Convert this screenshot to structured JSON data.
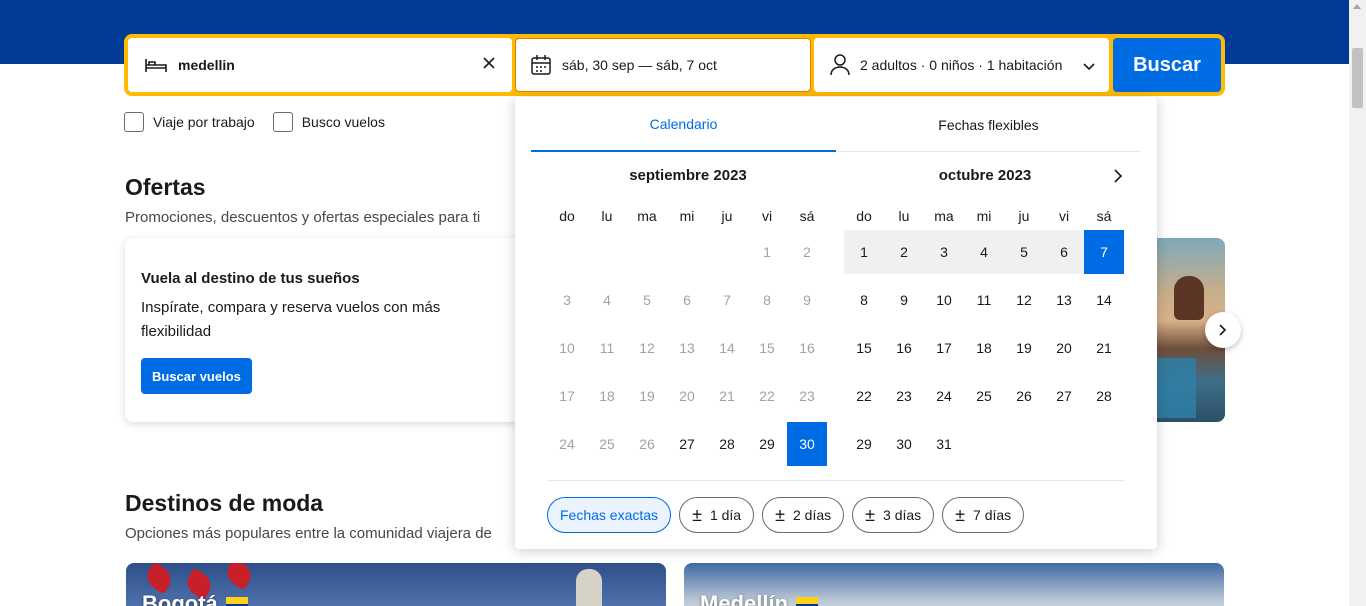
{
  "search": {
    "destination": "medellin",
    "dates": "sáb, 30 sep — sáb, 7 oct",
    "guests": "2 adultos · 0 niños · 1 habitación",
    "button": "Buscar"
  },
  "checkboxes": {
    "work": "Viaje por trabajo",
    "flights": "Busco vuelos"
  },
  "offers": {
    "title": "Ofertas",
    "subtitle": "Promociones, descuentos y ofertas especiales para ti",
    "card_title": "Vuela al destino de tus sueños",
    "card_text": "Inspírate, compara y reserva vuelos con más flexibilidad",
    "card_button": "Buscar vuelos"
  },
  "trending": {
    "title": "Destinos de moda",
    "subtitle": "Opciones más populares entre la comunidad viajera de",
    "cards": [
      "Bogotá",
      "Medellín"
    ]
  },
  "calendar": {
    "tabs": [
      "Calendario",
      "Fechas flexibles"
    ],
    "weekdays": [
      "do",
      "lu",
      "ma",
      "mi",
      "ju",
      "vi",
      "sá"
    ],
    "months": [
      {
        "title": "septiembre 2023",
        "offset": 5,
        "days": 30,
        "past_until": 26,
        "selected": [
          30
        ],
        "range": []
      },
      {
        "title": "octubre 2023",
        "offset": 0,
        "days": 31,
        "past_until": 0,
        "selected": [
          7
        ],
        "range": [
          1,
          2,
          3,
          4,
          5,
          6
        ]
      }
    ],
    "chips": [
      "Fechas exactas",
      "1 día",
      "2 días",
      "3 días",
      "7 días"
    ]
  },
  "colors": {
    "brand_blue": "#003b95",
    "accent": "#006ce4",
    "search_border": "#febb02"
  }
}
